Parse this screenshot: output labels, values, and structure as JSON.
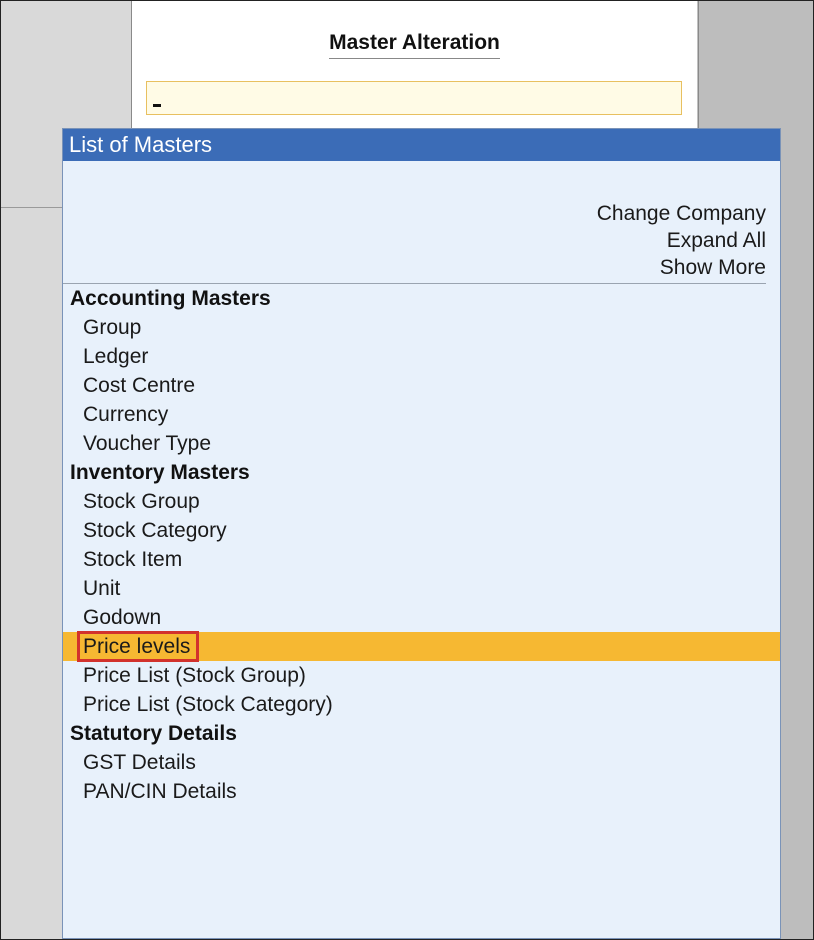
{
  "master_alteration": {
    "title": "Master Alteration",
    "input_value": ""
  },
  "list": {
    "title": "List of Masters",
    "options": [
      {
        "label": "Change Company"
      },
      {
        "label": "Expand All"
      },
      {
        "label": "Show More"
      }
    ],
    "sections": [
      {
        "heading": "Accounting Masters",
        "items": [
          {
            "label": "Group"
          },
          {
            "label": "Ledger"
          },
          {
            "label": "Cost Centre"
          },
          {
            "label": "Currency"
          },
          {
            "label": "Voucher Type"
          }
        ]
      },
      {
        "heading": "Inventory Masters",
        "items": [
          {
            "label": "Stock Group"
          },
          {
            "label": "Stock Category"
          },
          {
            "label": "Stock Item"
          },
          {
            "label": "Unit"
          },
          {
            "label": "Godown"
          },
          {
            "label": "Price levels",
            "selected": true
          },
          {
            "label": "Price List (Stock Group)"
          },
          {
            "label": "Price List (Stock Category)"
          }
        ]
      },
      {
        "heading": "Statutory Details",
        "items": [
          {
            "label": "GST Details"
          },
          {
            "label": "PAN/CIN Details"
          }
        ]
      }
    ]
  },
  "colors": {
    "header_blue": "#3b6cb7",
    "list_background": "#e8f1fb",
    "selection_highlight": "#f6b832",
    "annotation_red": "#d2322d"
  }
}
